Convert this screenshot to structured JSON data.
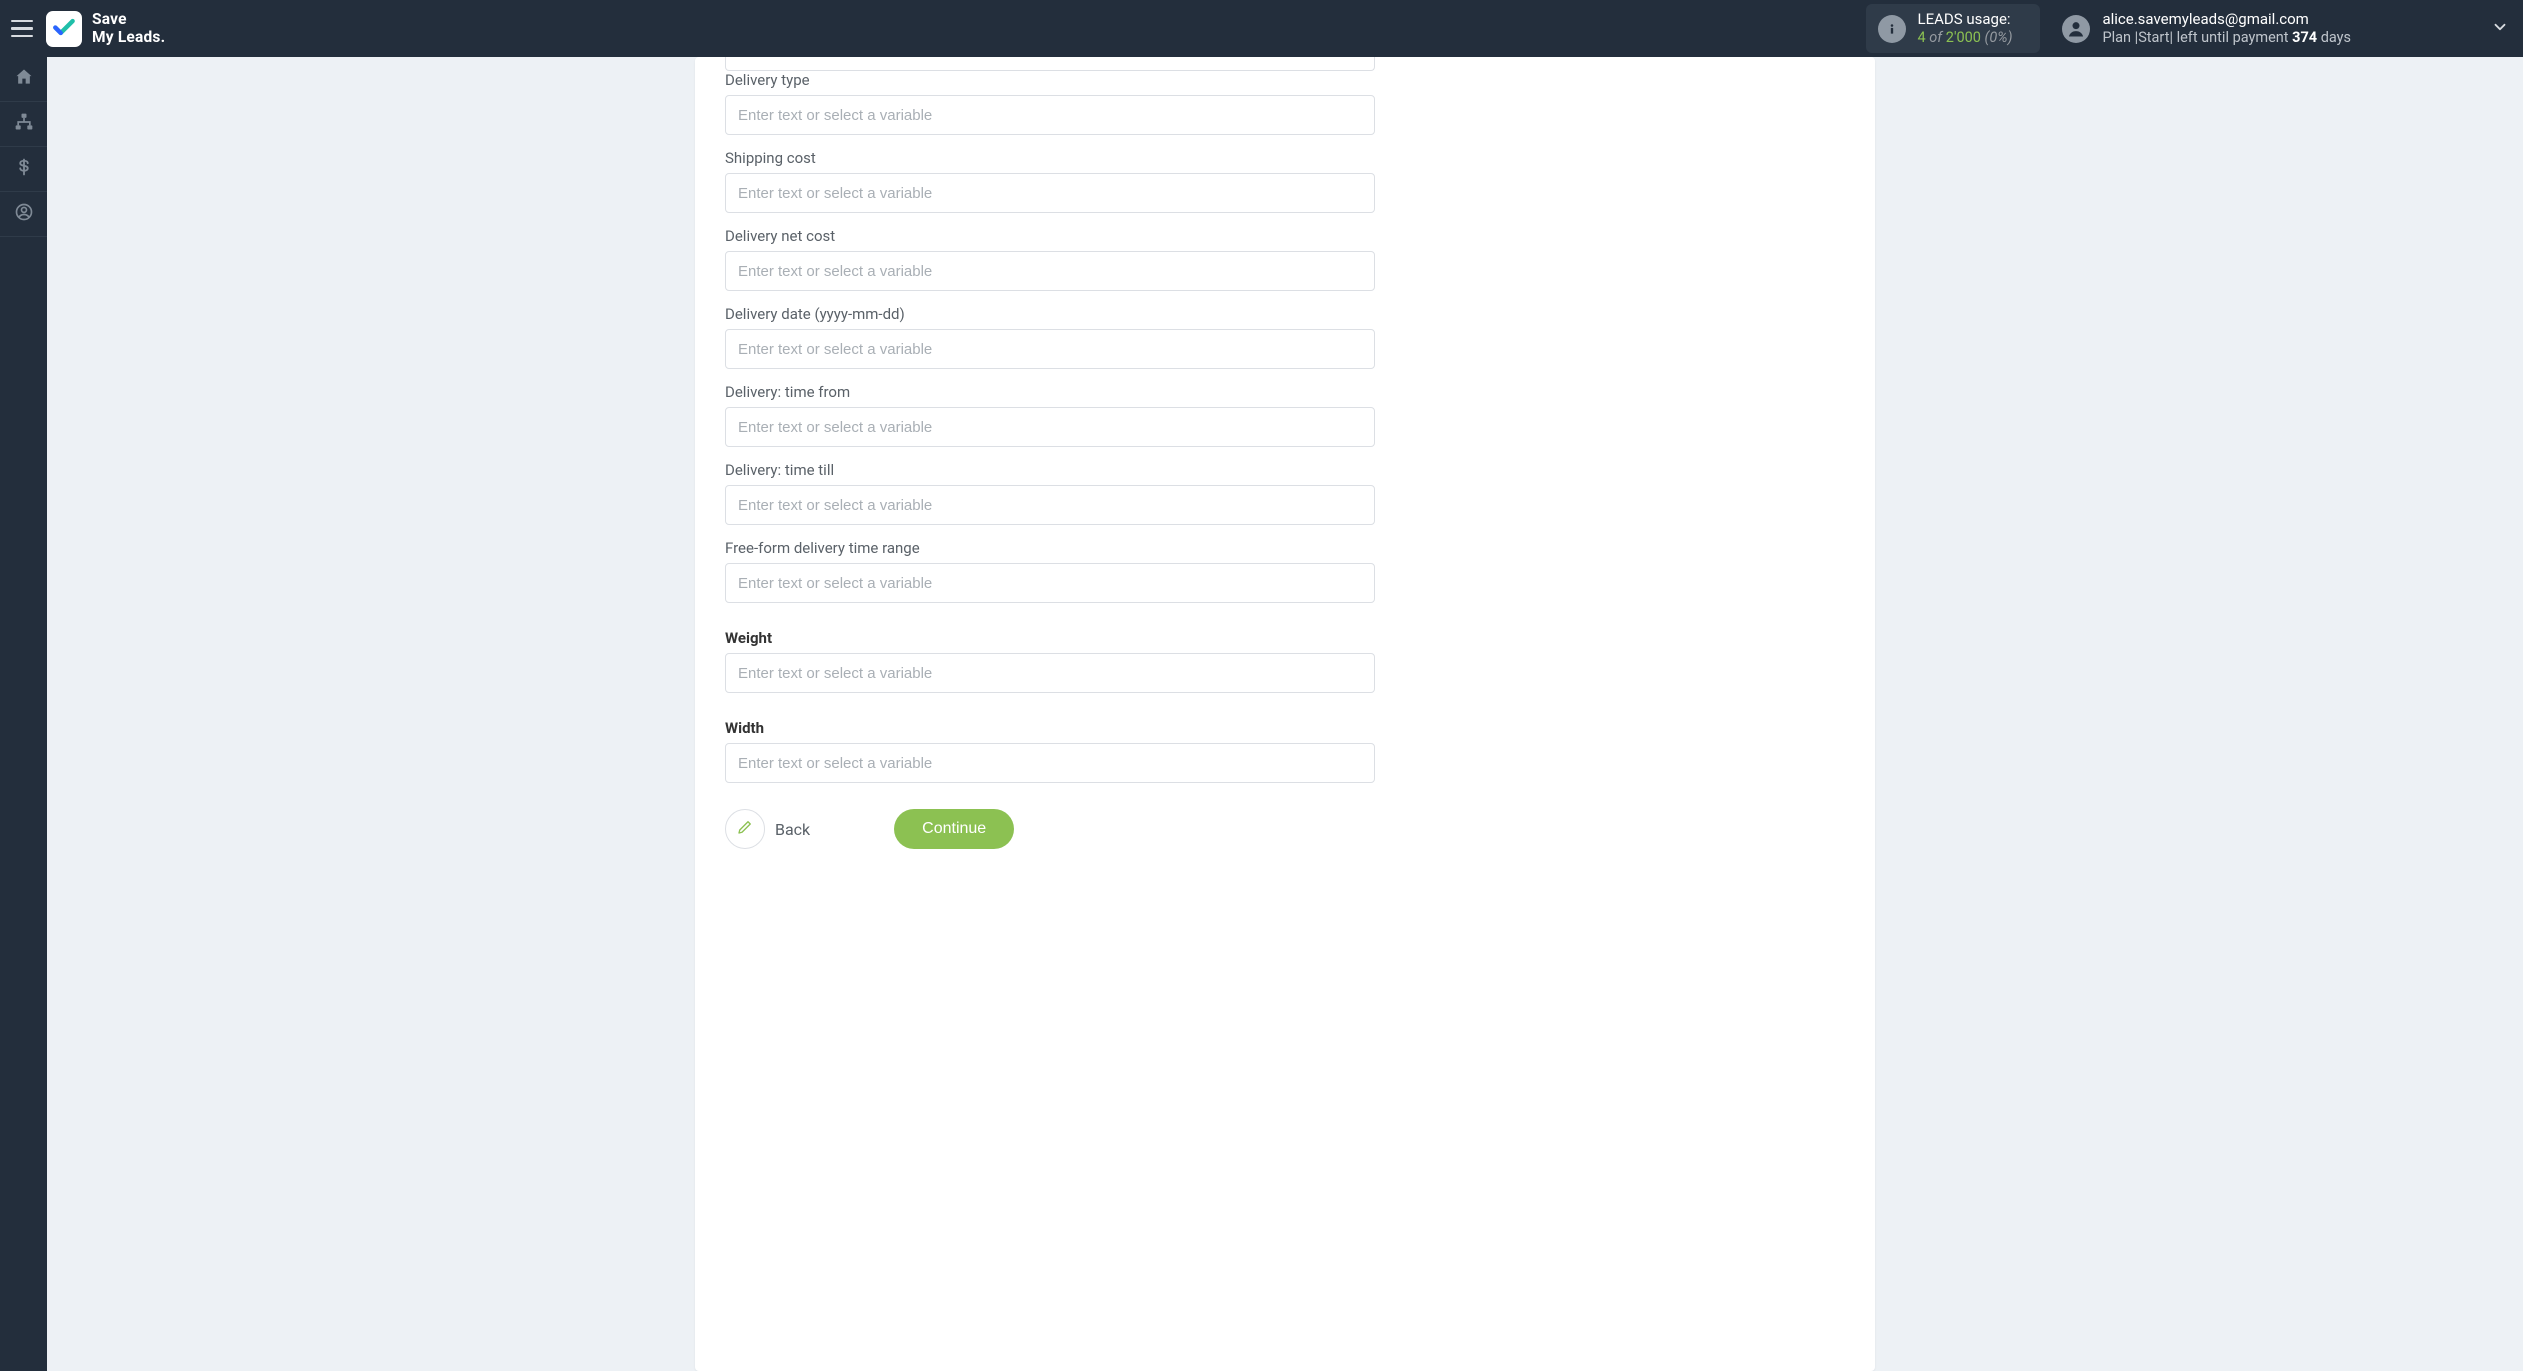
{
  "brand": {
    "line1": "Save",
    "line2": "My Leads."
  },
  "usage": {
    "label": "LEADS usage:",
    "current": "4",
    "of": "of",
    "limit": "2'000",
    "pct": "(0%)"
  },
  "user": {
    "email": "alice.savemyleads@gmail.com",
    "plan_prefix": "Plan |",
    "plan_name": "Start",
    "plan_mid": "| left until payment ",
    "days": "374",
    "plan_suffix": " days"
  },
  "form": {
    "placeholder": "Enter text or select a variable",
    "fields": [
      {
        "label": "Delivery type",
        "bold": false
      },
      {
        "label": "Shipping cost",
        "bold": false
      },
      {
        "label": "Delivery net cost",
        "bold": false
      },
      {
        "label": "Delivery date (yyyy-mm-dd)",
        "bold": false
      },
      {
        "label": "Delivery: time from",
        "bold": false
      },
      {
        "label": "Delivery: time till",
        "bold": false
      },
      {
        "label": "Free-form delivery time range",
        "bold": false
      },
      {
        "label": "Weight",
        "bold": true
      },
      {
        "label": "Width",
        "bold": true
      }
    ],
    "back": "Back",
    "continue": "Continue"
  }
}
